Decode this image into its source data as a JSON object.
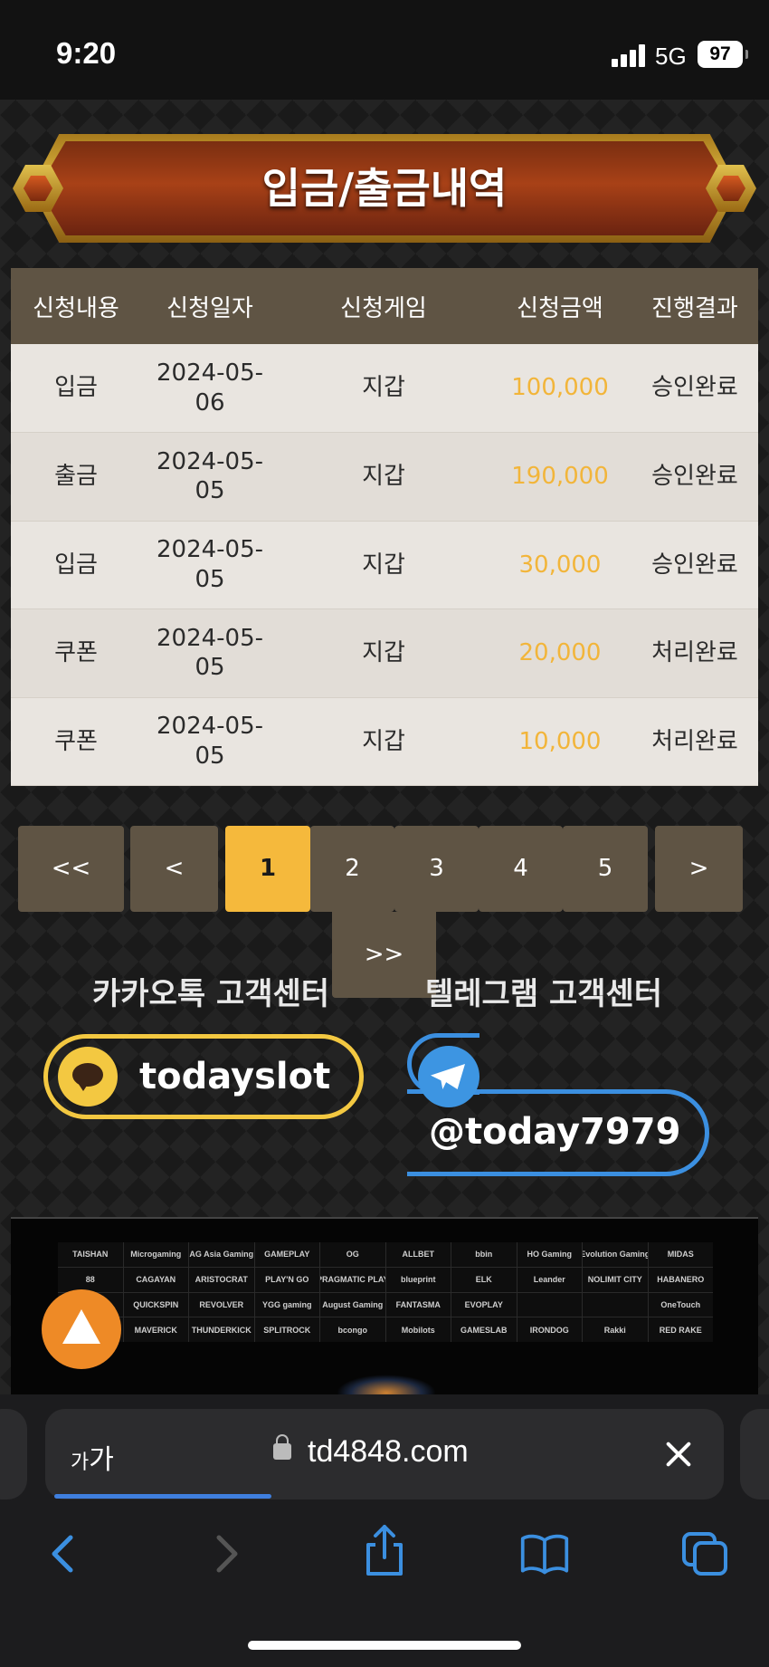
{
  "status_bar": {
    "time": "9:20",
    "network": "5G",
    "battery": "97"
  },
  "page": {
    "title": "입금/출금내역"
  },
  "table": {
    "headers": [
      "신청내용",
      "신청일자",
      "신청게임",
      "신청금액",
      "진행결과"
    ],
    "rows": [
      {
        "type": "입금",
        "date_line1": "2024-05-",
        "date_line2": "06",
        "game": "지갑",
        "amount": "100,000",
        "result": "승인완료"
      },
      {
        "type": "출금",
        "date_line1": "2024-05-",
        "date_line2": "05",
        "game": "지갑",
        "amount": "190,000",
        "result": "승인완료"
      },
      {
        "type": "입금",
        "date_line1": "2024-05-",
        "date_line2": "05",
        "game": "지갑",
        "amount": "30,000",
        "result": "승인완료"
      },
      {
        "type": "쿠폰",
        "date_line1": "2024-05-",
        "date_line2": "05",
        "game": "지갑",
        "amount": "20,000",
        "result": "처리완료"
      },
      {
        "type": "쿠폰",
        "date_line1": "2024-05-",
        "date_line2": "05",
        "game": "지갑",
        "amount": "10,000",
        "result": "처리완료"
      }
    ]
  },
  "pagination": {
    "first": "<<",
    "prev": "<",
    "pages": [
      "1",
      "2",
      "3",
      "4",
      "5"
    ],
    "active_page": "1",
    "next": ">",
    "last": ">>"
  },
  "support": {
    "kakao_label": "카카오톡 고객센터",
    "kakao_id": "todayslot",
    "telegram_label": "텔레그램 고객센터",
    "telegram_id": "@today7979"
  },
  "providers": [
    "TAISHAN",
    "Microgaming",
    "AG Asia Gaming",
    "GAMEPLAY",
    "OG",
    "ALLBET",
    "bbin",
    "HO Gaming",
    "Evolution Gaming",
    "MIDAS",
    "88",
    "CAGAYAN",
    "ARISTOCRAT",
    "PLAY'N GO",
    "PRAGMATIC PLAY",
    "blueprint",
    "ELK",
    "Leander",
    "NOLIMIT CITY",
    "HABANERO",
    "",
    "QUICKSPIN",
    "REVOLVER",
    "YGG gaming",
    "August Gaming",
    "FANTASMA",
    "EVOPLAY",
    "",
    "",
    "OneTouch",
    "",
    "MAVERICK",
    "THUNDERKICK",
    "SPLITROCK",
    "bcongo",
    "Mobilots",
    "GAMESLAB",
    "IRONDOG",
    "Rakki",
    "RED RAKE"
  ],
  "browser": {
    "text_size_small": "가",
    "text_size_large": "가",
    "url": "td4848.com",
    "page_load_progress": 0.32
  },
  "colors": {
    "table_header_bg": "#5f5444",
    "amount_color": "#f2b53a",
    "active_page_bg": "#f5b93c",
    "kakao_yellow": "#f3c841",
    "telegram_blue": "#3b8fe0",
    "scroll_top_orange": "#ee8a26"
  },
  "icons": {
    "kakao": "kakao-talk-icon",
    "telegram": "telegram-icon",
    "scroll_top": "arrow-up-icon",
    "lock": "lock-icon",
    "close": "close-icon",
    "back": "chevron-left-icon",
    "forward": "chevron-right-icon",
    "share": "share-icon",
    "bookmarks": "book-icon",
    "tabs": "tabs-icon"
  }
}
